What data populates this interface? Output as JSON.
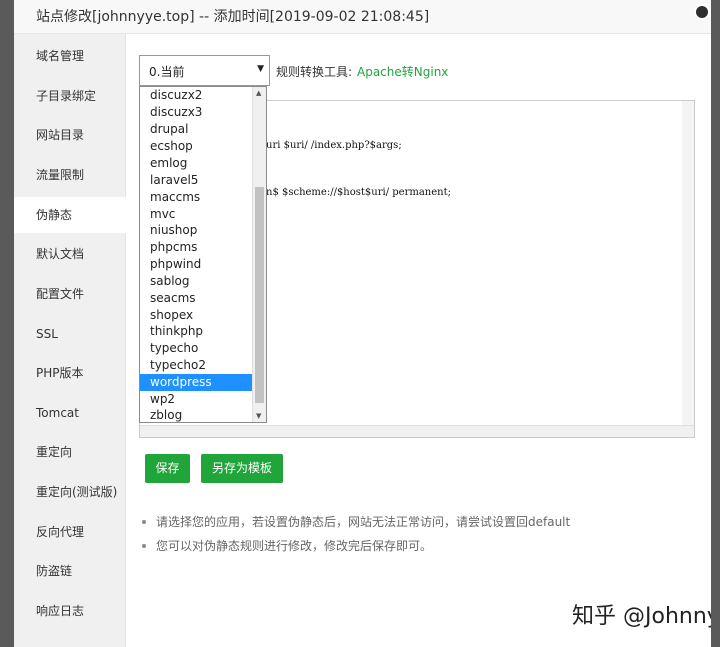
{
  "dialog": {
    "title": "站点修改[johnnyye.top] -- 添加时间[2019-09-02 21:08:45]"
  },
  "sidebar": {
    "items": [
      {
        "label": "域名管理"
      },
      {
        "label": "子目录绑定"
      },
      {
        "label": "网站目录"
      },
      {
        "label": "流量限制"
      },
      {
        "label": "伪静态"
      },
      {
        "label": "默认文档"
      },
      {
        "label": "配置文件"
      },
      {
        "label": "SSL"
      },
      {
        "label": "PHP版本"
      },
      {
        "label": "Tomcat"
      },
      {
        "label": "重定向"
      },
      {
        "label": "重定向(测试版)"
      },
      {
        "label": "反向代理"
      },
      {
        "label": "防盗链"
      },
      {
        "label": "响应日志"
      }
    ],
    "active_index": 4
  },
  "rewrite": {
    "selected": "0.当前",
    "tool_label": "规则转换工具:",
    "tool_link": "Apache转Nginx",
    "options": [
      "discuzx2",
      "discuzx3",
      "drupal",
      "ecshop",
      "emlog",
      "laravel5",
      "maccms",
      "mvc",
      "niushop",
      "phpcms",
      "phpwind",
      "sablog",
      "seacms",
      "shopex",
      "thinkphp",
      "typecho",
      "typecho2",
      "wordpress",
      "wp2",
      "zblog"
    ],
    "highlighted_option": "wordpress",
    "editor_lines": [
      "uri $uri/ /index.php?$args;",
      "n$ $scheme://$host$uri/ permanent;"
    ]
  },
  "buttons": {
    "save": "保存",
    "save_as_template": "另存为模板"
  },
  "tips": [
    "请选择您的应用，若设置伪静态后，网站无法正常访问，请尝试设置回default",
    "您可以对伪静态规则进行修改，修改完后保存即可。"
  ],
  "watermark": "知乎 @Johnny",
  "colors": {
    "accent_green": "#20a53a",
    "highlight_blue": "#1e90ff",
    "sidebar_bg": "#f0f0f0"
  }
}
